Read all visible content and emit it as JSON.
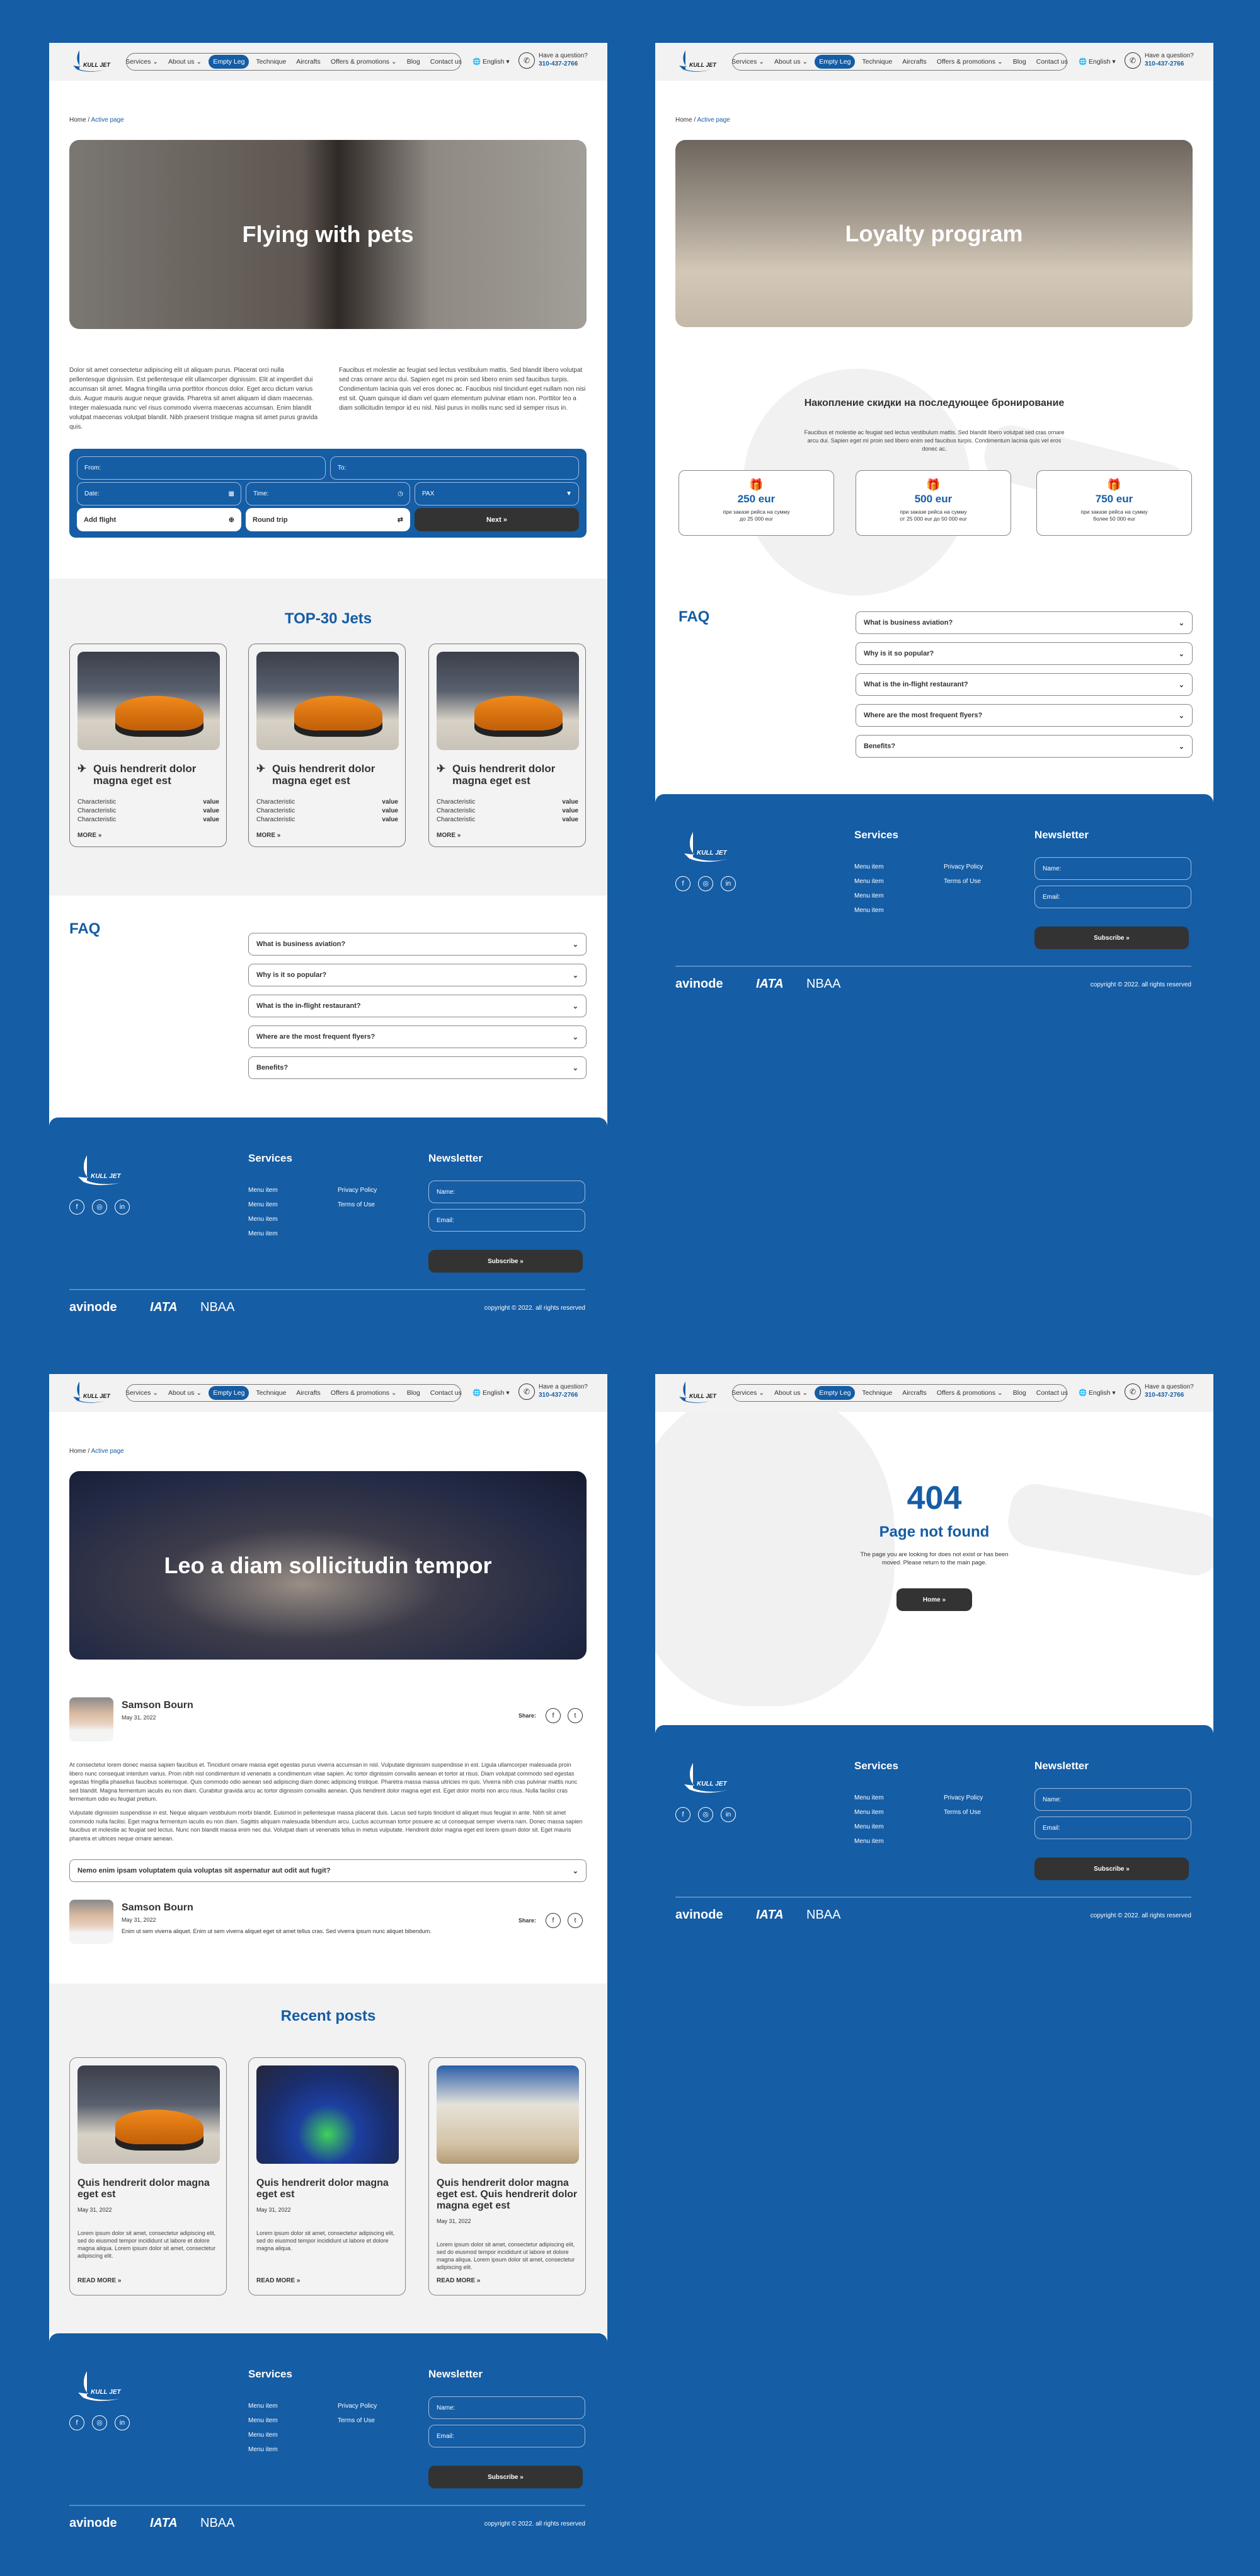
{
  "header": {
    "nav": [
      "Services",
      "About us",
      "Empty Leg",
      "Technique",
      "Aircrafts",
      "Offers & promotions",
      "Blog",
      "Contact us"
    ],
    "language": "English",
    "question": "Have a question?",
    "phone": "310-437-2766",
    "logo_text": "KULL JET"
  },
  "breadcrumb": {
    "home": "Home",
    "active": "Active page"
  },
  "footer": {
    "services_title": "Services",
    "menu": [
      "Menu item",
      "Menu item",
      "Menu item",
      "Menu item"
    ],
    "links": [
      "Privacy Policy",
      "Terms of Use"
    ],
    "newsletter_title": "Newsletter",
    "name_placeholder": "Name:",
    "email_placeholder": "Email:",
    "subscribe": "Subscribe",
    "partners": [
      "avinode",
      "IATA",
      "NBAA"
    ],
    "copyright": "copyright © 2022. all rights reserved"
  },
  "pets": {
    "hero_title": "Flying with pets",
    "para1": "Dolor sit amet consectetur adipiscing elit ut aliquam purus. Placerat orci nulla pellentesque dignissim. Est pellentesque elit ullamcorper dignissim. Elit at imperdiet dui accumsan sit amet. Magna fringilla urna porttitor rhoncus dolor. Eget arcu dictum varius duis. Augue mauris augue neque gravida. Pharetra sit amet aliquam id diam maecenas. Integer malesuada nunc vel risus commodo viverra maecenas accumsan. Enim blandit volutpat maecenas volutpat blandit. Nibh praesent tristique magna sit amet purus gravida quis.",
    "para2": "Faucibus et molestie ac feugiat sed lectus vestibulum mattis. Sed blandit libero volutpat sed cras ornare arcu dui. Sapien eget mi proin sed libero enim sed faucibus turpis. Condimentum lacinia quis vel eros donec ac. Faucibus nisl tincidunt eget nullam non nisi est sit. Quam quisque id diam vel quam elementum pulvinar etiam non. Porttitor leo a diam sollicitudin tempor id eu nisl. Nisl purus in mollis nunc sed id semper risus in.",
    "form": {
      "from": "From:",
      "to": "To:",
      "date": "Date:",
      "time": "Time:",
      "pax": "PAX",
      "add_flight": "Add flight",
      "round_trip": "Round trip",
      "next": "Next"
    },
    "jets_title": "TOP-30 Jets",
    "jets": [
      {
        "title": "Quis hendrerit dolor magna eget est",
        "rows": [
          [
            "Characteristic",
            "value"
          ],
          [
            "Characteristic",
            "value"
          ],
          [
            "Characteristic",
            "value"
          ]
        ],
        "more": "MORE"
      },
      {
        "title": "Quis hendrerit dolor magna eget est",
        "rows": [
          [
            "Characteristic",
            "value"
          ],
          [
            "Characteristic",
            "value"
          ],
          [
            "Characteristic",
            "value"
          ]
        ],
        "more": "MORE"
      },
      {
        "title": "Quis hendrerit dolor magna eget est",
        "rows": [
          [
            "Characteristic",
            "value"
          ],
          [
            "Characteristic",
            "value"
          ],
          [
            "Characteristic",
            "value"
          ]
        ],
        "more": "MORE"
      }
    ]
  },
  "faq": {
    "title": "FAQ",
    "items": [
      "What is business aviation?",
      "Why is it so popular?",
      "What is the in-flight restaurant?",
      "Where are the most frequent flyers?",
      "Benefits?"
    ]
  },
  "loyalty": {
    "hero_title": "Loyalty program",
    "title": "Накопление скидки на последующее бронирование",
    "text": "Faucibus et molestie ac feugiat sed lectus vestibulum mattis. Sed blandit libero volutpat sed cras ornare arcu dui. Sapien eget mi proin sed libero enim sed faucibus turpis. Condimentum lacinia quis vel eros donec ac.",
    "tiers": [
      {
        "amount": "250 eur",
        "line1": "при заказе рейса на сумму",
        "line2": "до 25 000 eur"
      },
      {
        "amount": "500 eur",
        "line1": "при заказе рейса на сумму",
        "line2": "от 25 000 eur до 50 000 eur"
      },
      {
        "amount": "750 eur",
        "line1": "при заказе рейса на сумму",
        "line2": "более 50 000 eur"
      }
    ]
  },
  "blog": {
    "hero_title": "Leo a diam sollicitudin tempor",
    "author": "Samson Bourn",
    "date": "May 31, 2022",
    "share": "Share:",
    "para1": "At consectetur lorem donec massa sapien faucibus et. Tincidunt ornare massa eget egestas purus viverra accumsan in nisl. Vulputate dignissim suspendisse in est. Ligula ullamcorper malesuada proin libero nunc consequat interdum varius. Proin nibh nisl condimentum id venenatis a condimentum vitae sapien. Ac tortor dignissim convallis aenean et tortor at risus. Diam volutpat commodo sed egestas egestas fringilla phasellus faucibus scelerisque. Quis commodo odio aenean sed adipiscing diam donec adipiscing tristique. Pharetra massa massa ultricies mi quis. Viverra nibh cras pulvinar mattis nunc sed blandit. Magna fermentum iaculis eu non diam. Curabitur gravida arcu ac tortor dignissim convallis aenean. Quis hendrerit dolor magna eget est. Eget dolor morbi non arcu risus. Nulla facilisi cras fermentum odio eu feugiat pretium.",
    "para2": "Vulputate dignissim suspendisse in est. Neque aliquam vestibulum morbi blandit. Euismod in pellentesque massa placerat duis. Lacus sed turpis tincidunt id aliquet risus feugiat in ante. Nibh sit amet commodo nulla facilisi. Eget magna fermentum iaculis eu non diam. Sagittis aliquam malesuada bibendum arcu. Luctus accumsan tortor posuere ac ut consequat semper viverra nam. Donec massa sapien faucibus et molestie ac feugiat sed lectus. Nunc non blandit massa enim nec dui. Volutpat diam ut venenatis tellus in metus vulputate. Hendrerit dolor magna eget est lorem ipsum dolor sit. Eget mauris pharetra et ultrices neque ornare aenean.",
    "question": "Nemo enim ipsam voluptatem quia voluptas sit aspernatur aut odit aut fugit?",
    "comment": "Enim ut sem viverra aliquet. Enim ut sem viverra aliquet eget sit amet tellus cras. Sed viverra ipsum nunc aliquet bibendum.",
    "recent_title": "Recent posts",
    "posts": [
      {
        "title": "Quis hendrerit dolor magna eget est",
        "date": "May 31, 2022",
        "text": "Lorem ipsum dolor sit amet, consectetur adipiscing elit, sed do eiusmod tempor incididunt ut labore et dolore magna aliqua. Lorem ipsum dolor sit amet, consectetur adipiscing elit.",
        "more": "READ MORE"
      },
      {
        "title": "Quis hendrerit dolor magna eget est",
        "date": "May 31, 2022",
        "text": "Lorem ipsum dolor sit amet, consectetur adipiscing elit, sed do eiusmod tempor incididunt ut labore et dolore magna aliqua.",
        "more": "READ MORE"
      },
      {
        "title": "Quis hendrerit dolor magna eget est. Quis hendrerit dolor magna eget est",
        "date": "May 31, 2022",
        "text": "Lorem ipsum dolor sit amet, consectetur adipiscing elit, sed do eiusmod tempor incididunt ut labore et dolore magna aliqua. Lorem ipsum dolor sit amet, consectetur adipiscing elit.",
        "more": "READ MORE"
      }
    ]
  },
  "notfound": {
    "code": "404",
    "title": "Page not found",
    "text": "The page you are looking for does not exist or has been moved. Please return to the main page.",
    "home": "Home"
  },
  "colors": {
    "brand": "#155da5",
    "dark": "#333333",
    "light": "#f2f2f2"
  }
}
